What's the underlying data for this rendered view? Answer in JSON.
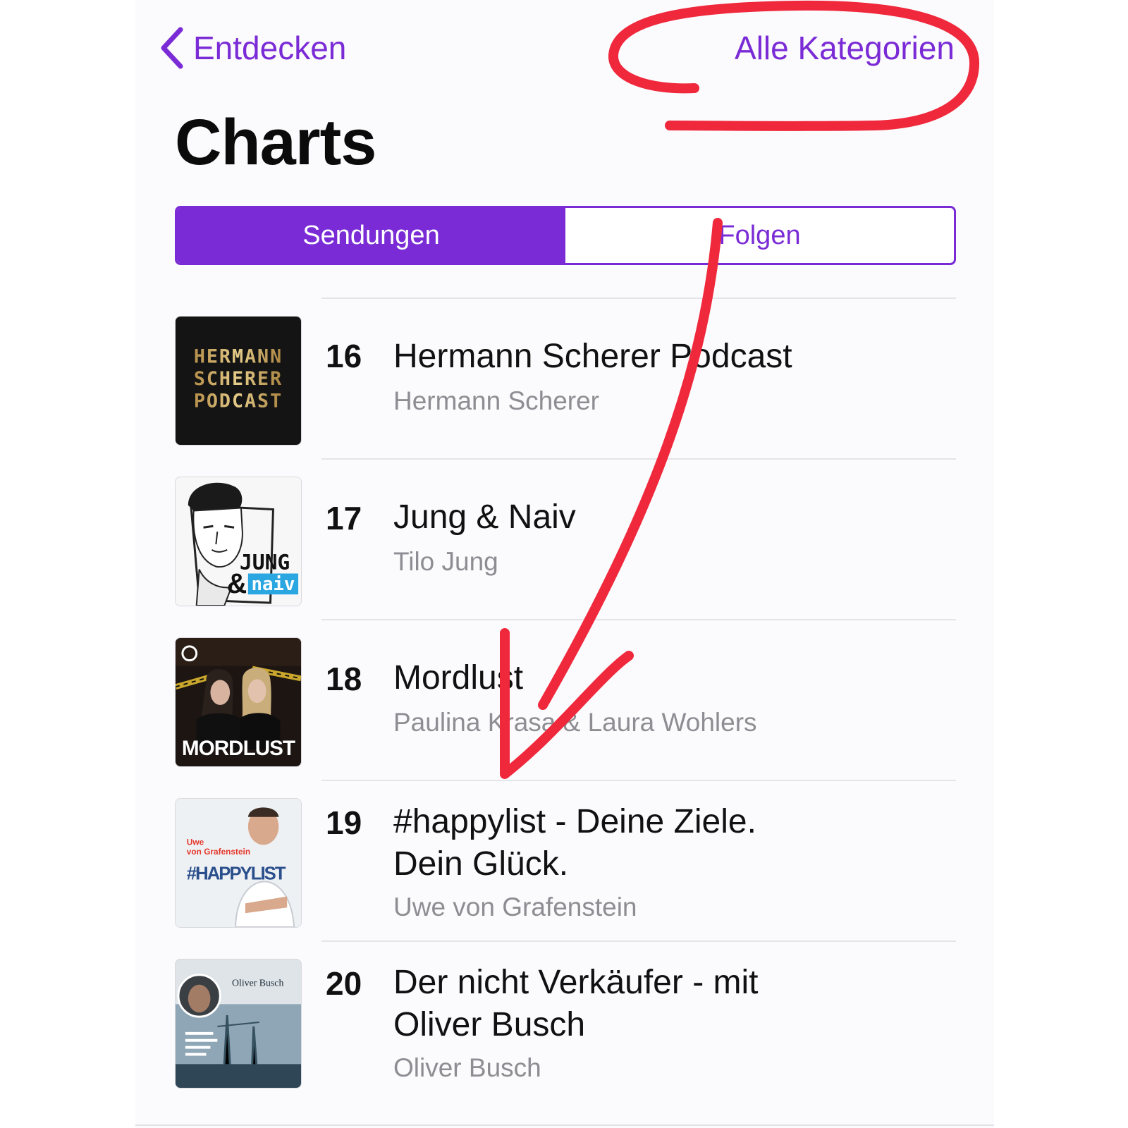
{
  "nav": {
    "back_label": "Entdecken",
    "right_label": "Alle Kategorien"
  },
  "page": {
    "title": "Charts"
  },
  "segments": [
    {
      "label": "Sendungen",
      "selected": true
    },
    {
      "label": "Folgen",
      "selected": false
    }
  ],
  "podcasts": [
    {
      "rank": "16",
      "title": "Hermann Scherer Podcast",
      "author": "Hermann Scherer",
      "art_lines": [
        "HERMANN",
        "SCHERER",
        "PODCAST"
      ]
    },
    {
      "rank": "17",
      "title": "Jung & Naiv",
      "author": "Tilo Jung",
      "art_lines": [
        "JUNG",
        "&",
        "naiv"
      ]
    },
    {
      "rank": "18",
      "title": "Mordlust",
      "author": "Paulina Krasa & Laura Wohlers",
      "art_lines": [
        "MORDLUST"
      ]
    },
    {
      "rank": "19",
      "title": "#happylist - Deine Ziele. Dein Glück.",
      "author": "Uwe von Grafenstein",
      "art_lines": [
        "Uwe",
        "von Grafenstein",
        "#HAPPYLIST"
      ]
    },
    {
      "rank": "20",
      "title": "Der nicht Verkäufer - mit Oliver Busch",
      "author": "Oliver Busch",
      "art_lines": [
        "Oliver Busch"
      ]
    }
  ],
  "colors": {
    "accent": "#7a2bd6",
    "annotation": "#f0283c",
    "secondary_text": "#8d8d93"
  },
  "annotations": {
    "circle": "red-ellipse-around-alle-kategorien",
    "arrow": "red-arrow-pointing-down"
  }
}
